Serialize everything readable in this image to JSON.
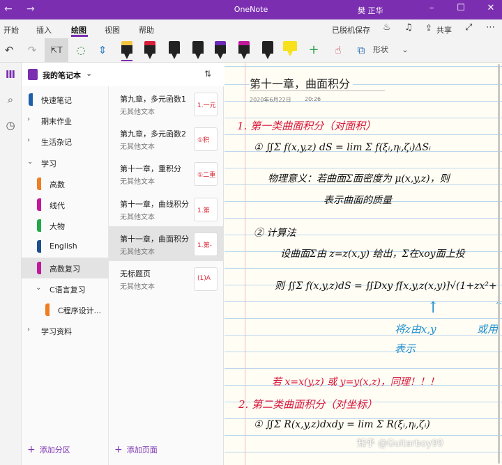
{
  "titlebar": {
    "title": "OneNote",
    "user": "樊 正华",
    "back_icon": "back-arrow-icon",
    "forward_icon": "forward-arrow-icon"
  },
  "ribbon": {
    "tabs": [
      "开始",
      "插入",
      "绘图",
      "视图",
      "帮助"
    ],
    "active_tab": "绘图",
    "right": {
      "offline": "已脱机保存",
      "share": "共享"
    }
  },
  "toolbar": {
    "shape_label": "形状",
    "pens": [
      {
        "color": "#f5c542",
        "name": "pen-yellow-icon"
      },
      {
        "color": "#d81f3c",
        "name": "pen-red-icon"
      },
      {
        "color": "#222222",
        "name": "pen-black-icon"
      },
      {
        "color": "#222222",
        "name": "pen-black-2-icon"
      },
      {
        "color": "#6c2ab8",
        "name": "pen-purple-icon"
      },
      {
        "color": "#c2189a",
        "name": "pen-magenta-icon"
      },
      {
        "color": "#222222",
        "name": "pen-black-3-icon"
      },
      {
        "color": "#f7e11c",
        "name": "highlighter-yellow-icon"
      }
    ]
  },
  "notebook": {
    "name": "我的笔记本",
    "sections": [
      {
        "label": "快速笔记",
        "color": "#1f5fa8",
        "indent": 0,
        "expander": "",
        "selected": false
      },
      {
        "label": "期末作业",
        "color": "",
        "indent": 0,
        "expander": ">",
        "selected": false
      },
      {
        "label": "生活杂记",
        "color": "",
        "indent": 0,
        "expander": ">",
        "selected": false
      },
      {
        "label": "学习",
        "color": "",
        "indent": 0,
        "expander": "v",
        "selected": false
      },
      {
        "label": "高数",
        "color": "#ef7d22",
        "indent": 1,
        "expander": "",
        "selected": false
      },
      {
        "label": "线代",
        "color": "#c2189a",
        "indent": 1,
        "expander": "",
        "selected": false
      },
      {
        "label": "大物",
        "color": "#22a84a",
        "indent": 1,
        "expander": "",
        "selected": false
      },
      {
        "label": "English",
        "color": "#1f4f8c",
        "indent": 1,
        "expander": "",
        "selected": false
      },
      {
        "label": "高数复习",
        "color": "#c2189a",
        "indent": 1,
        "expander": "",
        "selected": true
      },
      {
        "label": "C语言复习",
        "color": "",
        "indent": 1,
        "expander": "v",
        "selected": false
      },
      {
        "label": "C程序设计...",
        "color": "#ef7d22",
        "indent": 2,
        "expander": "",
        "selected": false
      },
      {
        "label": "学习资料",
        "color": "",
        "indent": 0,
        "expander": ">",
        "selected": false
      }
    ],
    "add_section": "添加分区"
  },
  "pages": {
    "items": [
      {
        "title": "第九章，多元函数1",
        "subtitle": "无其他文本",
        "thumb": "1.一元",
        "selected": false
      },
      {
        "title": "第九章，多元函数2",
        "subtitle": "无其他文本",
        "thumb": "①积",
        "selected": false
      },
      {
        "title": "第十一章，重积分",
        "subtitle": "无其他文本",
        "thumb": "①二重",
        "selected": false
      },
      {
        "title": "第十一章，曲线积分",
        "subtitle": "无其他文本",
        "thumb": "1.第",
        "selected": false
      },
      {
        "title": "第十一章，曲面积分",
        "subtitle": "无其他文本",
        "thumb": "1.第-",
        "selected": true
      },
      {
        "title": "无标题页",
        "subtitle": "无其他文本",
        "thumb": "(1)A",
        "selected": false
      }
    ],
    "add_page": "添加页面"
  },
  "page": {
    "title": "第十一章，曲面积分",
    "date": "2020年6月22日",
    "time": "20:26",
    "ink": [
      {
        "text": "1. 第一类曲面积分（对面积）",
        "color": "#d8163a"
      },
      {
        "text": "① ∬Σ f(x,y,z) dS = lim Σ f(ξᵢ,ηᵢ,ζᵢ)ΔSᵢ",
        "color": "#111111"
      },
      {
        "text": "物理意义：若曲面Σ面密度为 μ(x,y,z)，则",
        "color": "#111111"
      },
      {
        "text": "表示曲面的质量",
        "color": "#111111"
      },
      {
        "text": "② 计算法",
        "color": "#111111"
      },
      {
        "text": "设曲面Σ由 z=z(x,y) 给出，Σ在xoy面上投",
        "color": "#111111"
      },
      {
        "text": "则 ∬Σ f(x,y,z)dS = ∬Dxy f[x,y,z(x,y)]√(1+zx²+",
        "color": "#111111"
      },
      {
        "text": "将z由x,y",
        "color": "#1f8fd0"
      },
      {
        "text": "表示",
        "color": "#1f8fd0"
      },
      {
        "text": "或用",
        "color": "#1f8fd0"
      },
      {
        "text": "若 x=x(y,z) 或 y=y(x,z)，同理！！！",
        "color": "#d8163a"
      },
      {
        "text": "2. 第二类曲面积分（对坐标）",
        "color": "#d8163a"
      },
      {
        "text": "① ∬Σ R(x,y,z)dxdy = lim Σ R(ξᵢ,ηᵢ,ζᵢ)",
        "color": "#111111"
      }
    ],
    "watermark": "知乎 @Guitarboy99"
  }
}
